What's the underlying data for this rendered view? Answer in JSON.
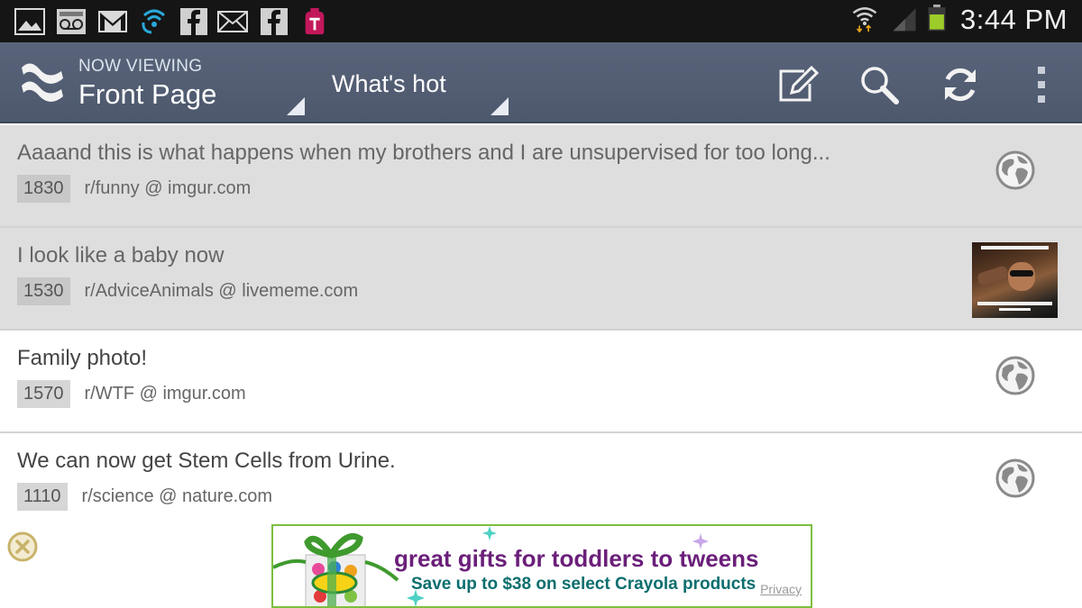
{
  "status_bar": {
    "time": "3:44 PM",
    "notification_icons": [
      "gallery-icon",
      "voicemail-icon",
      "gmail-icon",
      "sync-icon",
      "facebook-icon",
      "email-icon",
      "facebook-icon",
      "tmobile-icon"
    ],
    "battery_color": "#9ccc29"
  },
  "action_bar": {
    "now_viewing_label": "NOW VIEWING",
    "page_title": "Front Page",
    "sort_label": "What's hot",
    "background": "#59647a"
  },
  "posts": [
    {
      "title": "Aaaand this is what happens when my brothers and I are unsupervised for too long...",
      "score": "1830",
      "source": "r/funny @ imgur.com",
      "visited": true,
      "thumb": "globe-icon"
    },
    {
      "title": "I look like a baby now",
      "score": "1530",
      "source": "r/AdviceAnimals @ livememe.com",
      "visited": true,
      "thumb": "meme-thumbnail"
    },
    {
      "title": "Family photo!",
      "score": "1570",
      "source": "r/WTF @ imgur.com",
      "visited": false,
      "thumb": "globe-icon"
    },
    {
      "title": "We can now get Stem Cells from Urine.",
      "score": "1110",
      "source": "r/science @ nature.com",
      "visited": false,
      "thumb": "globe-icon"
    }
  ],
  "ad": {
    "headline": "great gifts for toddlers to tweens",
    "subline": "Save up to $38 on select Crayola products",
    "privacy": "Privacy",
    "brand": "Crayola"
  }
}
